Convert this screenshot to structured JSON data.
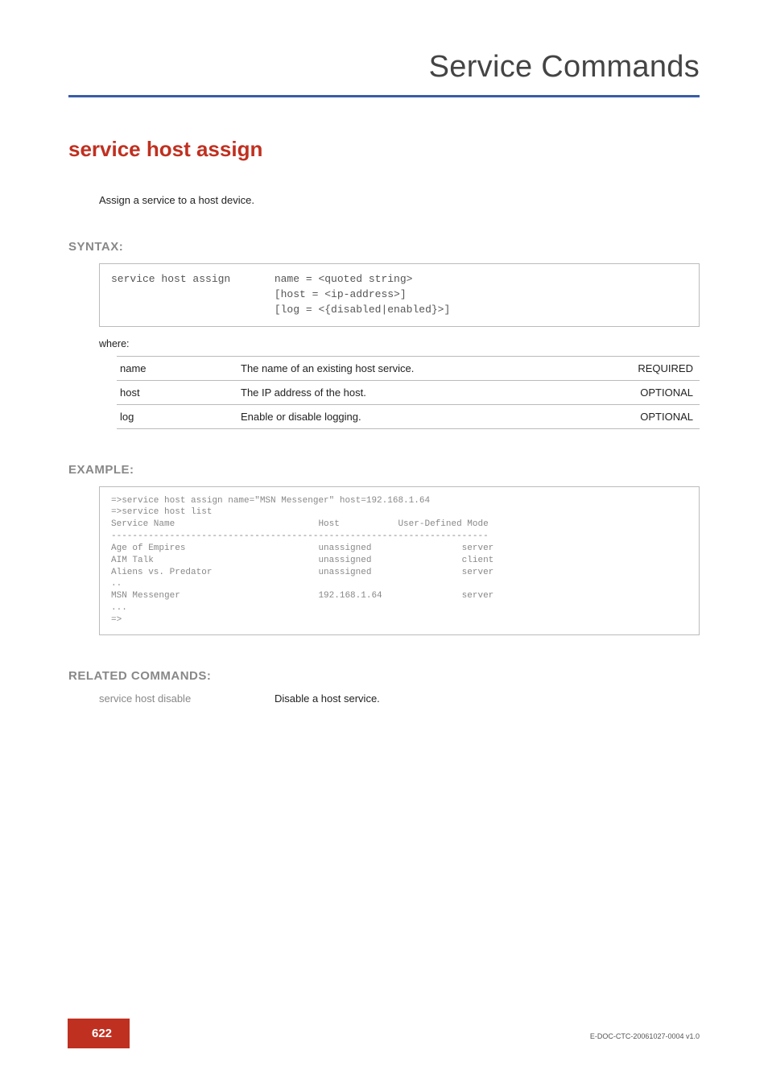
{
  "header": {
    "title": "Service Commands"
  },
  "command": {
    "title": "service host assign",
    "description": "Assign a  service to a host device."
  },
  "syntax": {
    "label": "SYNTAX:",
    "text": "service host assign       name = <quoted string>\n                          [host = <ip-address>]\n                          [log = <{disabled|enabled}>]",
    "where_label": "where:",
    "params": [
      {
        "name": "name",
        "desc": "The name of an existing host service.",
        "req": "REQUIRED"
      },
      {
        "name": "host",
        "desc": "The IP address of the host.",
        "req": "OPTIONAL"
      },
      {
        "name": "log",
        "desc": "Enable or disable logging.",
        "req": "OPTIONAL"
      }
    ]
  },
  "example": {
    "label": "EXAMPLE:",
    "text": "=>service host assign name=\"MSN Messenger\" host=192.168.1.64\n=>service host list\nService Name                           Host           User-Defined Mode\n-----------------------------------------------------------------------\nAge of Empires                         unassigned                 server\nAIM Talk                               unassigned                 client\nAliens vs. Predator                    unassigned                 server\n..\nMSN Messenger                          192.168.1.64               server\n...\n=>"
  },
  "related": {
    "label": "RELATED COMMANDS:",
    "items": [
      {
        "cmd": "service host disable",
        "desc": "Disable a host service."
      }
    ]
  },
  "footer": {
    "page": "622",
    "docid": "E-DOC-CTC-20061027-0004 v1.0"
  }
}
